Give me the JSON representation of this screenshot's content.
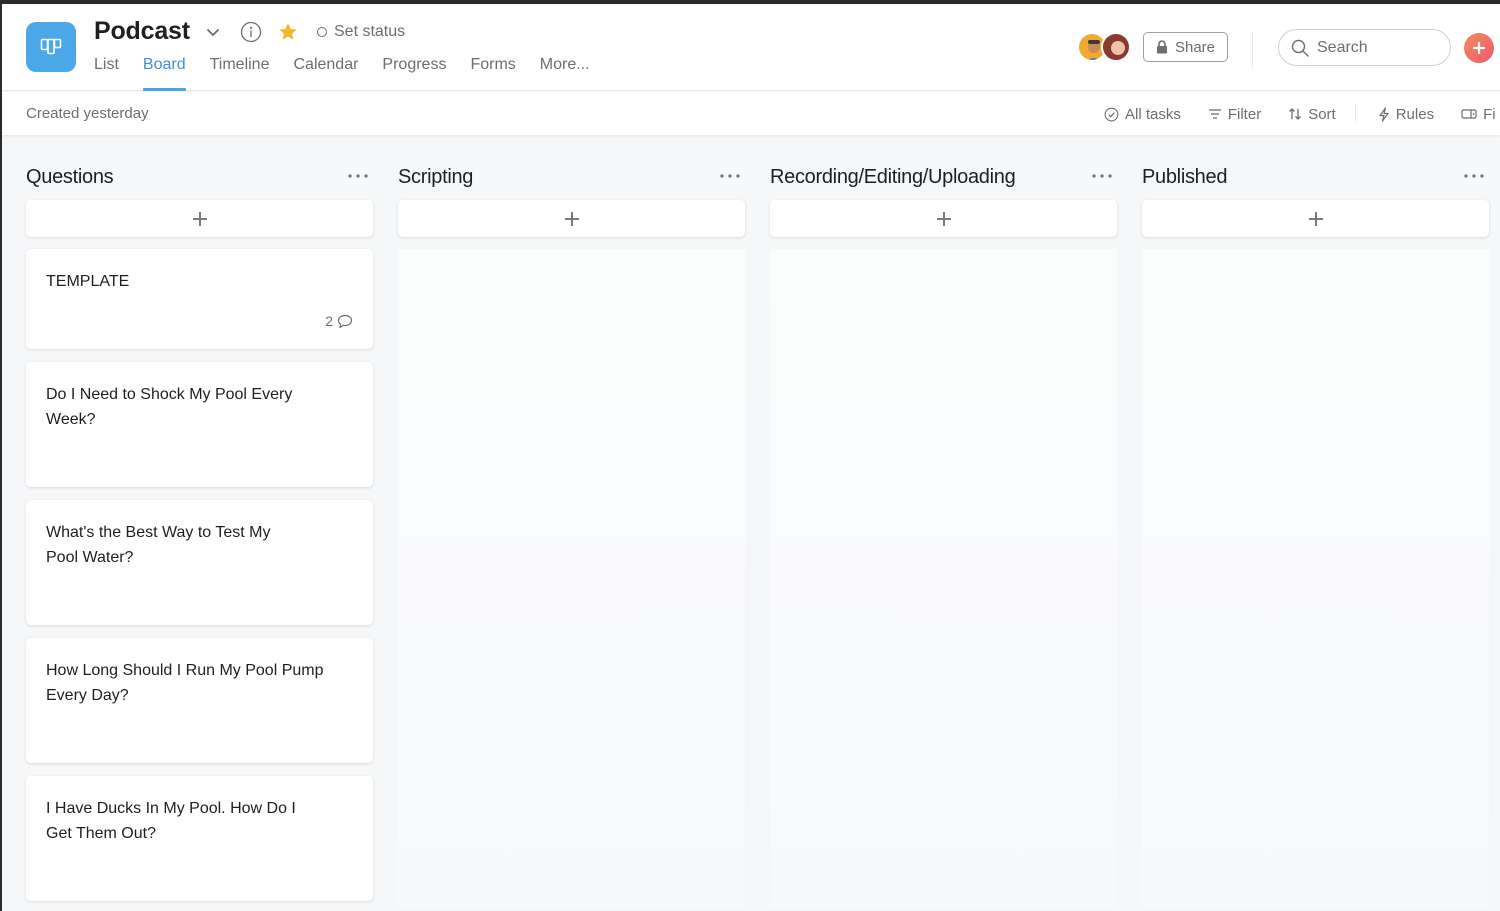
{
  "project": {
    "title": "Podcast",
    "icon": "board-icon",
    "icon_color": "#4ba8e8",
    "starred": true,
    "status_label": "Set status"
  },
  "tabs": [
    {
      "label": "List",
      "active": false
    },
    {
      "label": "Board",
      "active": true
    },
    {
      "label": "Timeline",
      "active": false
    },
    {
      "label": "Calendar",
      "active": false
    },
    {
      "label": "Progress",
      "active": false
    },
    {
      "label": "Forms",
      "active": false
    },
    {
      "label": "More...",
      "active": false
    }
  ],
  "header_right": {
    "members": [
      "member-avatar-1",
      "member-avatar-2"
    ],
    "share_label": "Share",
    "search_placeholder": "Search",
    "add_icon": "plus-icon"
  },
  "subbar": {
    "created_text": "Created yesterday",
    "tools": {
      "all_tasks": "All tasks",
      "filter": "Filter",
      "sort": "Sort",
      "rules": "Rules",
      "fields": "Fi"
    }
  },
  "columns": [
    {
      "title": "Questions",
      "cards": [
        {
          "title": "TEMPLATE",
          "comments": "2"
        },
        {
          "title": "Do I Need to Shock My Pool Every Week?"
        },
        {
          "title": "What's the Best Way to Test My Pool Water?"
        },
        {
          "title": "How Long Should I Run My Pool Pump Every Day?"
        },
        {
          "title": "I Have Ducks In My Pool. How Do I Get Them Out?"
        }
      ]
    },
    {
      "title": "Scripting",
      "cards": []
    },
    {
      "title": "Recording/Editing/Uploading",
      "cards": []
    },
    {
      "title": "Published",
      "cards": []
    }
  ]
}
